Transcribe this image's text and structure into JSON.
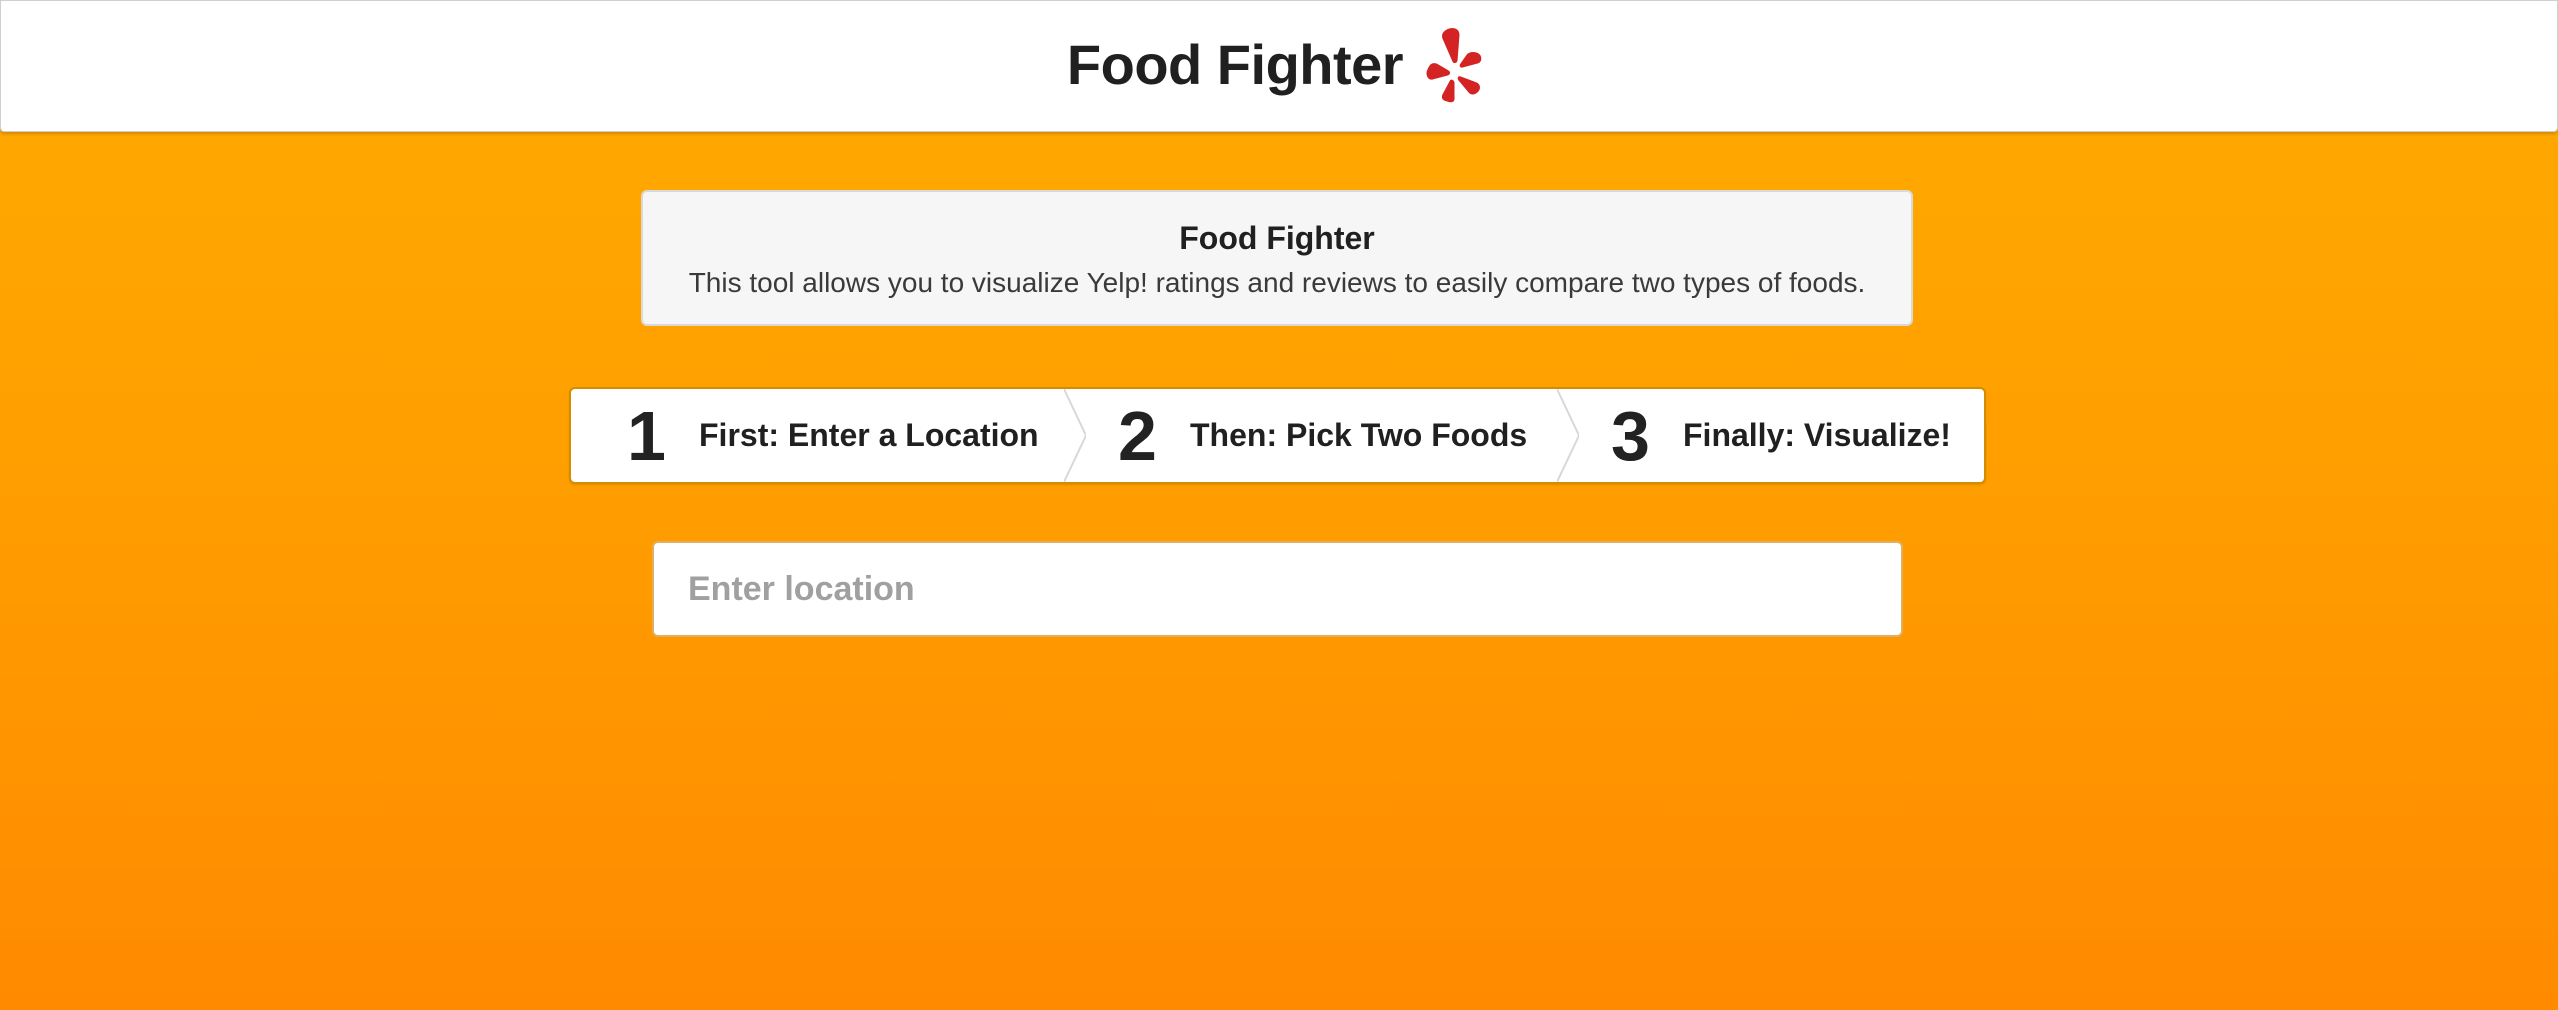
{
  "header": {
    "title": "Food Fighter",
    "logo_icon": "yelp-burst-icon",
    "logo_color": "#d32323"
  },
  "intro": {
    "title": "Food Fighter",
    "description": "This tool allows you to visualize Yelp! ratings and reviews to easily compare two types of foods."
  },
  "steps": [
    {
      "number": "1",
      "label": "First: Enter a Location"
    },
    {
      "number": "2",
      "label": "Then: Pick Two Foods"
    },
    {
      "number": "3",
      "label": "Finally: Visualize!"
    }
  ],
  "location": {
    "placeholder": "Enter location",
    "value": ""
  },
  "colors": {
    "background_top": "#ffab00",
    "background_bottom": "#ff8a00",
    "panel": "#f6f6f6",
    "text": "#202020"
  }
}
